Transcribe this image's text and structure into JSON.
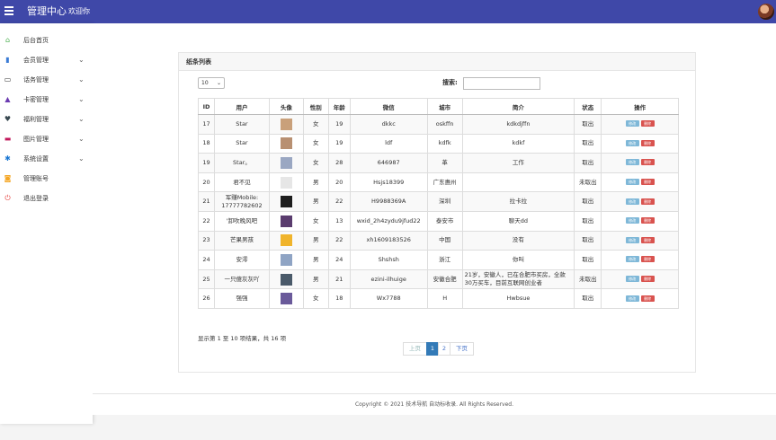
{
  "header": {
    "title": "管理中心",
    "welcome": "欢迎你"
  },
  "sidebar": {
    "items": [
      {
        "label": "后台首页",
        "icon": "home-icon",
        "color": "#4caf50",
        "glyph": "⌂",
        "chevron": false
      },
      {
        "label": "会员管理",
        "icon": "member-book-icon",
        "color": "#3a7bd5",
        "glyph": "▮",
        "chevron": true
      },
      {
        "label": "话务管理",
        "icon": "card-icon",
        "color": "#333333",
        "glyph": "▭",
        "chevron": true
      },
      {
        "label": "卡密管理",
        "icon": "pyramid-icon",
        "color": "#6a3ab0",
        "glyph": "▲",
        "chevron": true
      },
      {
        "label": "福利管理",
        "icon": "heart-icon",
        "color": "#37474f",
        "glyph": "♥",
        "chevron": true
      },
      {
        "label": "图片管理",
        "icon": "image-icon",
        "color": "#c2185b",
        "glyph": "▬",
        "chevron": true
      },
      {
        "label": "系统设置",
        "icon": "gear-icon",
        "color": "#1976d2",
        "glyph": "✱",
        "chevron": true
      },
      {
        "label": "管理账号",
        "icon": "account-icon",
        "color": "#f5a623",
        "glyph": "◙",
        "chevron": false
      },
      {
        "label": "退出登录",
        "icon": "power-icon",
        "color": "#e53935",
        "glyph": "⏻",
        "chevron": false
      }
    ]
  },
  "panel": {
    "title": "纸条列表",
    "page_length": "10",
    "search_label": "搜索:",
    "search_value": "",
    "columns": [
      "ID",
      "用户",
      "头像",
      "性别",
      "年龄",
      "微信",
      "城市",
      "简介",
      "状态",
      "操作"
    ],
    "rows": [
      {
        "id": "17",
        "user": "Star",
        "avatar_color": "#c9a07a",
        "gender": "女",
        "age": "19",
        "wechat": "dkkc",
        "city": "oskffn",
        "intro": "kdkdjffn",
        "status": "取出",
        "edit": "修改",
        "delete": "删除"
      },
      {
        "id": "18",
        "user": "Star",
        "avatar_color": "#b89072",
        "gender": "女",
        "age": "19",
        "wechat": "ldf",
        "city": "kdfk",
        "intro": "kdkf",
        "status": "取出",
        "edit": "修改",
        "delete": "删除"
      },
      {
        "id": "19",
        "user": "Star。",
        "avatar_color": "#9aa7c2",
        "gender": "女",
        "age": "28",
        "wechat": "646987",
        "city": "革",
        "intro": "工作",
        "status": "取出",
        "edit": "修改",
        "delete": "删除"
      },
      {
        "id": "20",
        "user": "君不见",
        "avatar_color": "#e6e6e6",
        "gender": "男",
        "age": "20",
        "wechat": "Hsjs18399",
        "city": "广东惠州",
        "intro": "",
        "status": "未取出",
        "edit": "修改",
        "delete": "删除"
      },
      {
        "id": "21",
        "user": "军赚Mobile: 17777782602",
        "avatar_color": "#1e1e1e",
        "gender": "男",
        "age": "22",
        "wechat": "H9988369A",
        "city": "深圳",
        "intro": "拉卡拉",
        "status": "取出",
        "edit": "修改",
        "delete": "删除"
      },
      {
        "id": "22",
        "user": "'卸吹晚风吧",
        "avatar_color": "#5a3c6e",
        "gender": "女",
        "age": "13",
        "wxid": "",
        "wechat": "wxid_2h4zydu9jfud22",
        "city": "泰安市",
        "intro": "聊天dd",
        "status": "取出",
        "edit": "修改",
        "delete": "删除"
      },
      {
        "id": "23",
        "user": "芒果男孩",
        "avatar_color": "#f0b42c",
        "gender": "男",
        "age": "22",
        "wechat": "xh1609183526",
        "city": "中国",
        "intro": "没有",
        "status": "取出",
        "edit": "修改",
        "delete": "删除"
      },
      {
        "id": "24",
        "user": "安澪",
        "avatar_color": "#8fa4c4",
        "gender": "男",
        "age": "24",
        "wechat": "Shshsh",
        "city": "浙江",
        "intro": "你叫",
        "status": "取出",
        "edit": "修改",
        "delete": "删除"
      },
      {
        "id": "25",
        "user": "一只傻灰灰吖",
        "avatar_color": "#4a5a6a",
        "gender": "男",
        "age": "21",
        "wechat": "ezini-ilhuige",
        "city": "安徽合肥",
        "intro": "21岁，安徽人，已在合肥市买房，全款30万买车，目前互联网创业者",
        "status": "未取出",
        "edit": "修改",
        "delete": "删除"
      },
      {
        "id": "26",
        "user": "强强",
        "avatar_color": "#6a5a9a",
        "gender": "女",
        "age": "18",
        "wechat": "Wx7788",
        "city": "H",
        "intro": "Hwbsue",
        "status": "取出",
        "edit": "修改",
        "delete": "删除"
      }
    ],
    "info": "显示第 1 至 10 项结果，共 16 项",
    "pagination": {
      "prev": "上页",
      "pages": [
        "1",
        "2"
      ],
      "next": "下页"
    }
  },
  "footer": {
    "text": "Copyright © 2021 技术导航 自动标收录. All Rights Reserved."
  }
}
